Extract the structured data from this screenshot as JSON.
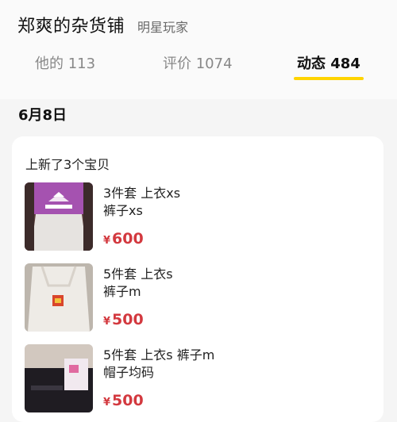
{
  "header": {
    "shop_name": "郑爽的杂货铺",
    "shop_tag": "明星玩家"
  },
  "tabs": [
    {
      "label": "他的 113"
    },
    {
      "label": "评价 1074"
    },
    {
      "label": "动态 484"
    }
  ],
  "active_tab_color": "#ffd400",
  "date": "6月8日",
  "card": {
    "title": "上新了3个宝贝",
    "items": [
      {
        "line1": "3件套 上衣xs",
        "line2": "裤子xs",
        "currency": "¥",
        "price": "600"
      },
      {
        "line1": "5件套 上衣s",
        "line2": "裤子m",
        "currency": "¥",
        "price": "500"
      },
      {
        "line1": "5件套 上衣s 裤子m",
        "line2": "帽子均码",
        "currency": "¥",
        "price": "500"
      }
    ]
  },
  "price_color": "#d3393f"
}
